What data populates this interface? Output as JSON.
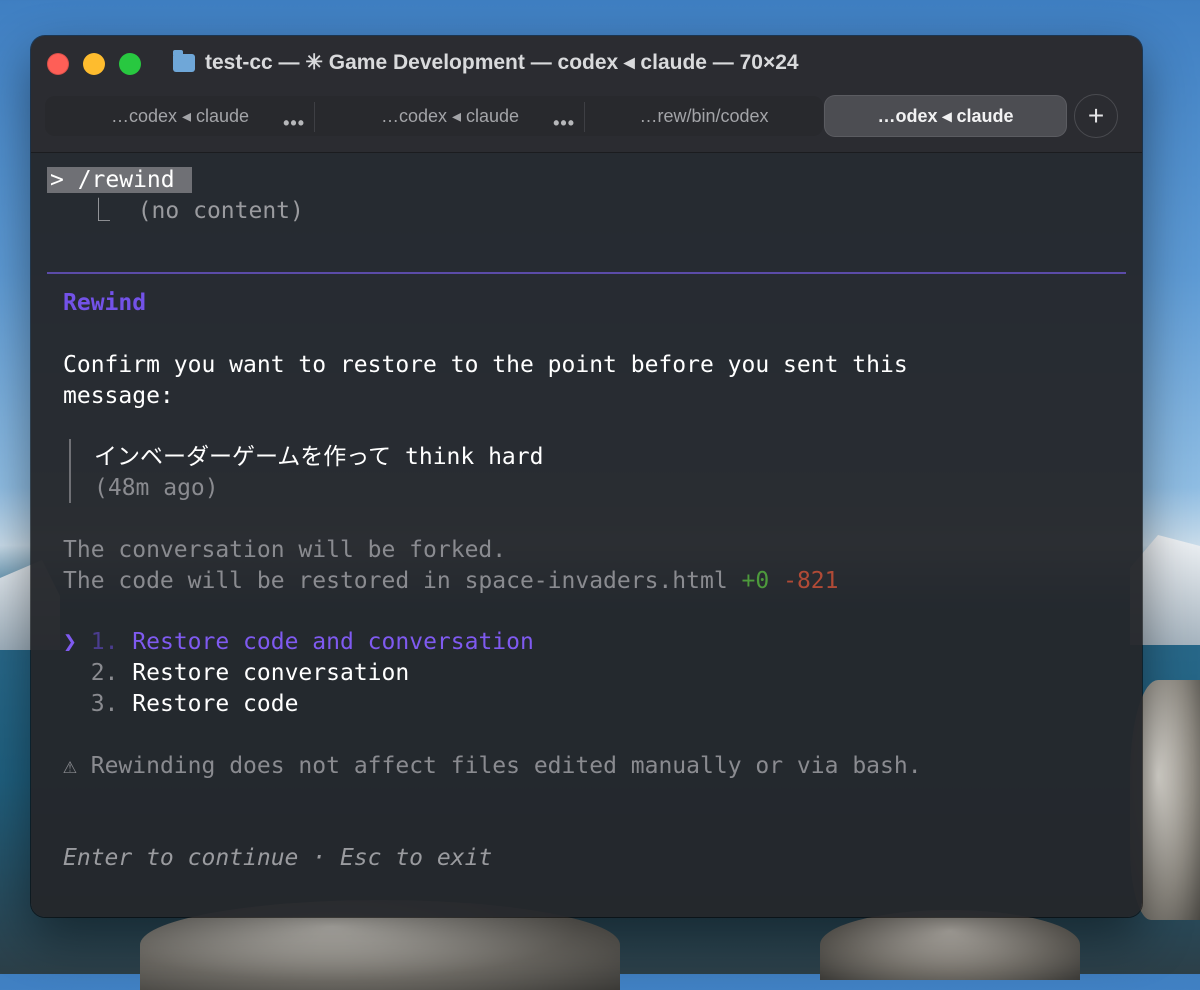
{
  "window": {
    "title": "test-cc — ✳ Game Development — codex ◂ claude — 70×24",
    "tabs": [
      {
        "label": "…codex ◂ claude",
        "more": "•••"
      },
      {
        "label": "…codex ◂ claude",
        "more": "•••"
      },
      {
        "label": "…rew/bin/codex"
      },
      {
        "label": "…odex ◂ claude",
        "active": true
      }
    ],
    "new_tab_label": "+"
  },
  "terminal": {
    "command": "> /rewind ",
    "command_output_prefix": "⎿",
    "command_output": "(no content)",
    "panel_title": "Rewind",
    "confirm_line1": "Confirm you want to restore to the point before you sent this",
    "confirm_line2": "message:",
    "quoted_message": "インベーダーゲームを作って think hard",
    "quoted_age": "(48m ago)",
    "fork_note": "The conversation will be forked.",
    "restore_note": "The code will be restored in space-invaders.html",
    "additions": "+0",
    "deletions": "-821",
    "options": [
      {
        "pointer": "❯",
        "number": "1.",
        "label": "Restore code and conversation"
      },
      {
        "number": "2.",
        "label": "Restore conversation"
      },
      {
        "number": "3.",
        "label": "Restore code"
      }
    ],
    "warning_icon": "⚠",
    "warning_text": "Rewinding does not affect files edited manually or via bash.",
    "hint": "Enter to continue · Esc to exit"
  },
  "colors": {
    "accent_purple": "#7f5af0",
    "diff_add": "#4d9a3c",
    "diff_del": "#b04a36"
  }
}
